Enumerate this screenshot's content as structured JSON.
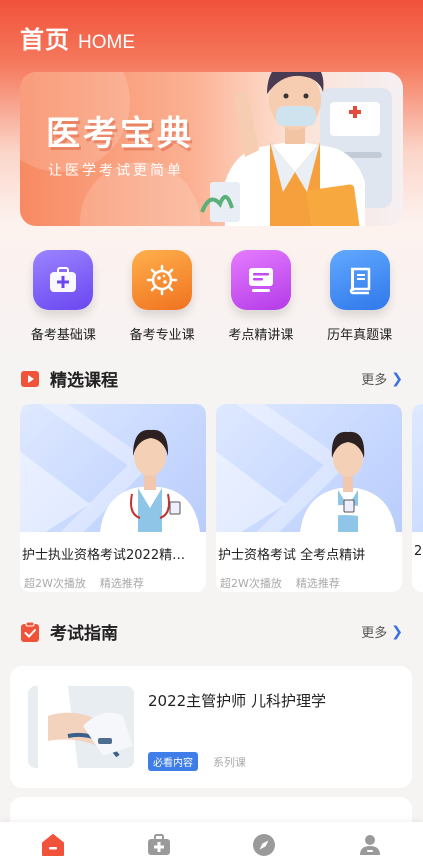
{
  "header": {
    "title": "首页",
    "title_en": "HOME"
  },
  "banner": {
    "title": "医考宝典",
    "subtitle": "让医学考试更简单"
  },
  "categories": [
    {
      "label": "备考基础课",
      "icon": "first-aid-kit-icon",
      "color": "#7b5cf0"
    },
    {
      "label": "备考专业课",
      "icon": "virus-icon",
      "color": "#f7862c"
    },
    {
      "label": "考点精讲课",
      "icon": "document-icon",
      "color": "#c54bf0"
    },
    {
      "label": "历年真题课",
      "icon": "book-icon",
      "color": "#3a86f0"
    }
  ],
  "featured": {
    "title": "精选课程",
    "more": "更多",
    "courses": [
      {
        "title": "护士执业资格考试2022精…",
        "plays": "超2W次播放",
        "tag": "精选推荐"
      },
      {
        "title": "护士资格考试 全考点精讲",
        "plays": "超2W次播放",
        "tag": "精选推荐"
      },
      {
        "title": "2"
      }
    ]
  },
  "guide": {
    "title": "考试指南",
    "more": "更多",
    "items": [
      {
        "title": "2022主管护师 儿科护理学",
        "tag": "必看内容",
        "type": "系列课"
      }
    ]
  },
  "tabbar": [
    {
      "name": "home",
      "icon": "home-icon",
      "active": true
    },
    {
      "name": "medical",
      "icon": "medical-kit-icon",
      "active": false
    },
    {
      "name": "discover",
      "icon": "compass-icon",
      "active": false
    },
    {
      "name": "profile",
      "icon": "user-icon",
      "active": false
    }
  ],
  "colors": {
    "primary": "#f0523a",
    "accent_blue": "#3a72e6",
    "tag_blue": "#3f7de8"
  }
}
